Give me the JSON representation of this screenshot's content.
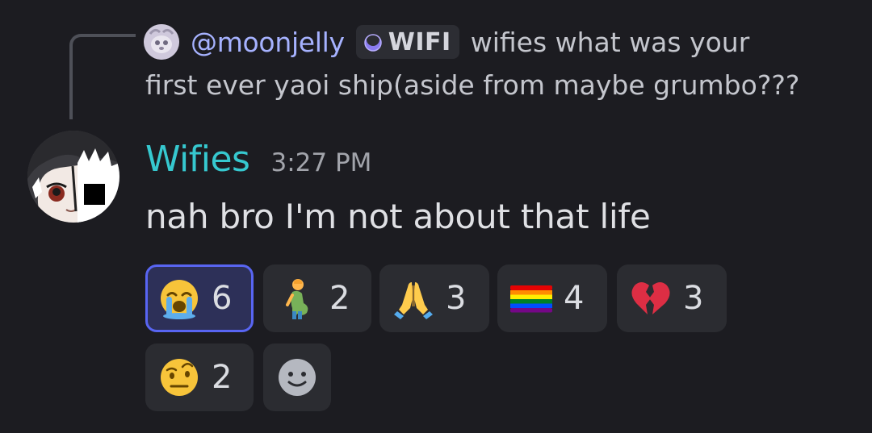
{
  "reply": {
    "author": "@moonjelly",
    "tag": "WIFI",
    "text_line1": "wifies what was your",
    "text_line2": "first ever yaoi ship(aside from maybe grumbo???"
  },
  "message": {
    "author": "Wifies",
    "timestamp": "3:27 PM",
    "text": "nah bro I'm not about that life"
  },
  "reactions": [
    {
      "emoji": "loudly-crying-face",
      "count": "6",
      "active": true
    },
    {
      "emoji": "pregnant-man",
      "count": "2",
      "active": false
    },
    {
      "emoji": "folded-hands",
      "count": "3",
      "active": false
    },
    {
      "emoji": "rainbow-flag",
      "count": "4",
      "active": false
    },
    {
      "emoji": "broken-heart",
      "count": "3",
      "active": false
    },
    {
      "emoji": "face-with-raised-eyebrow",
      "count": "2",
      "active": false
    }
  ],
  "colors": {
    "background": "#1c1c21",
    "reply_author": "#a6b2ff",
    "message_author": "#36c8cf",
    "active_reaction_border": "#5865f2",
    "reaction_background": "#2b2c31"
  }
}
